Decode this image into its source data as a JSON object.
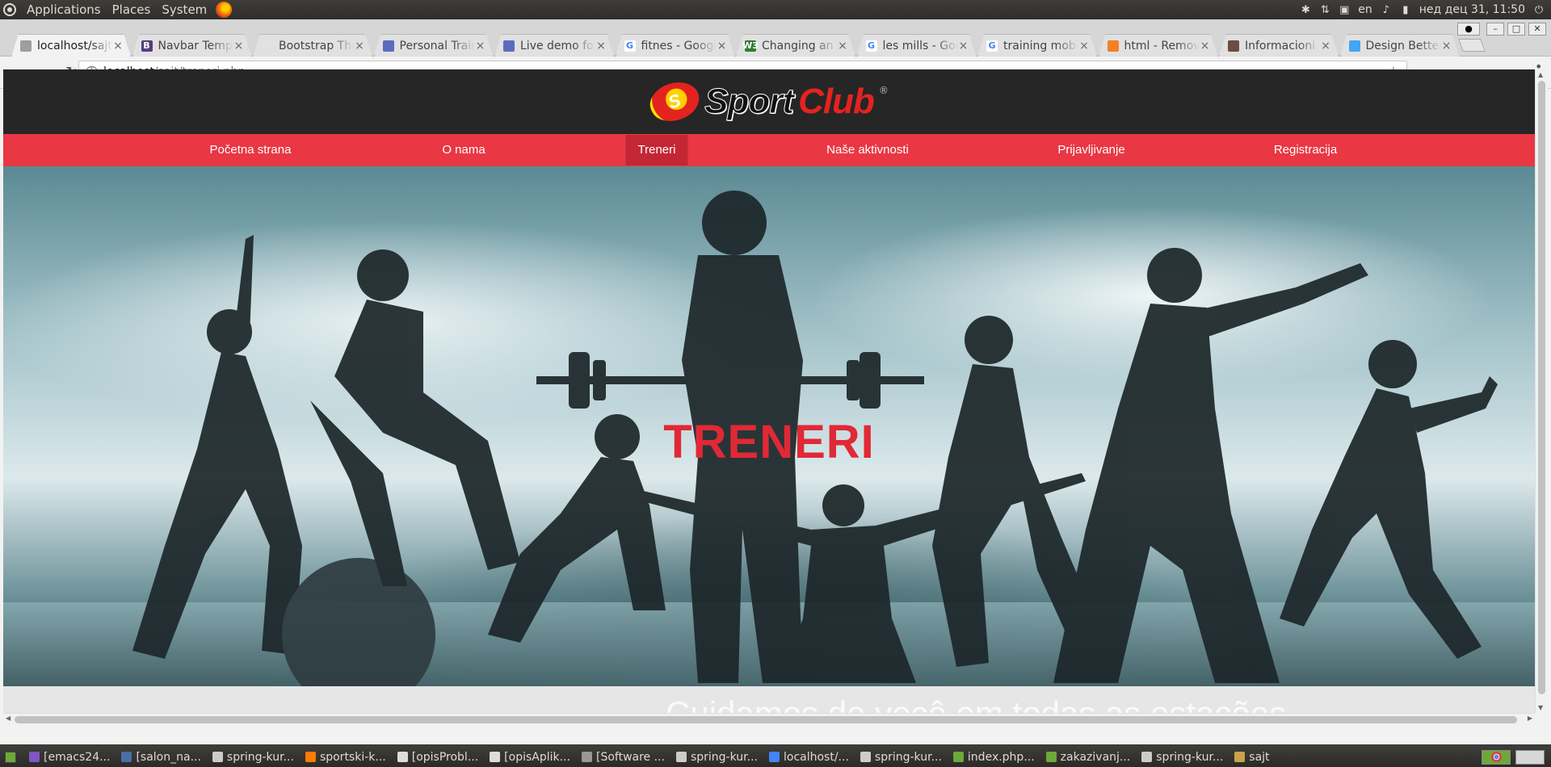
{
  "top_panel": {
    "menus": [
      "Applications",
      "Places",
      "System"
    ],
    "keyboard_layout": "en",
    "clock": "нед дец 31, 11:50"
  },
  "browser": {
    "tabs": [
      {
        "title": "localhost/sajt/treneri.php",
        "favicon": "page-icon",
        "active": true
      },
      {
        "title": "Navbar Templates",
        "favicon": "bootstrap-icon",
        "favicon_color": "#563d7c",
        "favicon_text": "B"
      },
      {
        "title": "Bootstrap Theme",
        "favicon": "blank-icon"
      },
      {
        "title": "Personal Trainer",
        "favicon": "mail-icon",
        "favicon_color": "#5c6bc0"
      },
      {
        "title": "Live demo for",
        "favicon": "mail-icon",
        "favicon_color": "#5c6bc0"
      },
      {
        "title": "fitnes - Google",
        "favicon": "google-icon",
        "favicon_color": "#4285f4",
        "favicon_text": "G"
      },
      {
        "title": "Changing an",
        "favicon": "w3schools-icon",
        "favicon_color": "#2e7d32",
        "favicon_text": "W3"
      },
      {
        "title": "les mills - Google",
        "favicon": "google-icon",
        "favicon_color": "#4285f4",
        "favicon_text": "G"
      },
      {
        "title": "training mobile",
        "favicon": "google-icon",
        "favicon_color": "#4285f4",
        "favicon_text": "G"
      },
      {
        "title": "html - Remove",
        "favicon": "stackoverflow-icon",
        "favicon_color": "#f48024"
      },
      {
        "title": "Informacioni",
        "favicon": "site-icon",
        "favicon_color": "#6d4c41"
      },
      {
        "title": "Design Better",
        "favicon": "site-icon",
        "favicon_color": "#42a5f5"
      }
    ],
    "url_host": "localhost",
    "url_path": "/sajt/treneri.php"
  },
  "site": {
    "logo_word_1": "Sport",
    "logo_word_2": "Club",
    "logo_badge": "S",
    "nav": [
      {
        "label": "Početna strana",
        "active": false
      },
      {
        "label": "O nama",
        "active": false
      },
      {
        "label": "Treneri",
        "active": true
      },
      {
        "label": "Naše aktivnosti",
        "active": false
      },
      {
        "label": "Prijavljivanje",
        "active": false
      },
      {
        "label": "Registracija",
        "active": false
      }
    ],
    "hero_title": "TRENERI",
    "tagline": "Cuidamos de você em todas as estações"
  },
  "taskbar": {
    "tasks": [
      {
        "label": "[emacs24...",
        "color": "#7e57c2"
      },
      {
        "label": "[salon_na...",
        "color": "#4a6fa5"
      },
      {
        "label": "spring-kur...",
        "color": "#cccccc"
      },
      {
        "label": "sportski-k...",
        "color": "#ff7a00"
      },
      {
        "label": "[opisProbl...",
        "color": "#dddddd"
      },
      {
        "label": "[opisAplik...",
        "color": "#dddddd"
      },
      {
        "label": "[Software ...",
        "color": "#999999"
      },
      {
        "label": "spring-kur...",
        "color": "#cccccc"
      },
      {
        "label": "localhost/...",
        "color": "#4285f4"
      },
      {
        "label": "spring-kur...",
        "color": "#cccccc"
      },
      {
        "label": "index.php...",
        "color": "#6ea83a"
      },
      {
        "label": "zakazivanj...",
        "color": "#6ea83a"
      },
      {
        "label": "spring-kur...",
        "color": "#cccccc"
      },
      {
        "label": "sajt",
        "color": "#c9a34a"
      }
    ]
  },
  "colors": {
    "nav_bg": "#e93744",
    "nav_active_bg": "#c42734",
    "header_bg": "#262626",
    "hero_title": "#e02936"
  }
}
